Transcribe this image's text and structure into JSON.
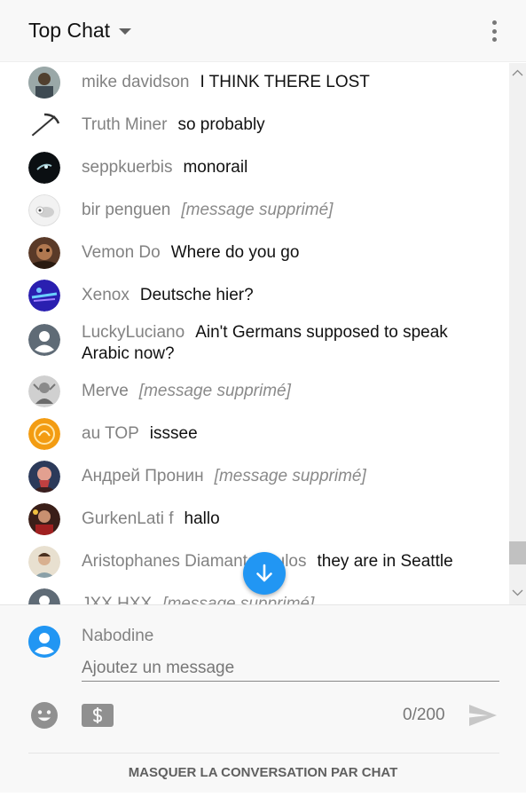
{
  "header": {
    "title": "Top Chat"
  },
  "messages": [
    {
      "author": "mike davidson",
      "text": "I THINK THERE LOST",
      "deleted": false,
      "avatar_color": "#6a7a80"
    },
    {
      "author": "Truth Miner",
      "text": "so probably",
      "deleted": false,
      "avatar_color": "#ffffff"
    },
    {
      "author": "seppkuerbis",
      "text": "monorail",
      "deleted": false,
      "avatar_color": "#0b0f12"
    },
    {
      "author": "bir penguen",
      "text": "[message supprimé]",
      "deleted": true,
      "avatar_color": "#e6e6e6"
    },
    {
      "author": "Vemon Do",
      "text": "Where do you go",
      "deleted": false,
      "avatar_color": "#5a3a28"
    },
    {
      "author": "Xenox",
      "text": "Deutsche hier?",
      "deleted": false,
      "avatar_color": "#2a1fb0"
    },
    {
      "author": "LuckyLuciano",
      "text": "Ain't Germans supposed to speak Arabic now?",
      "deleted": false,
      "avatar_color": "#5f6b76"
    },
    {
      "author": "Merve",
      "text": "[message supprimé]",
      "deleted": true,
      "avatar_color": "#b5b5b5"
    },
    {
      "author": "au TOP",
      "text": "isssee",
      "deleted": false,
      "avatar_color": "#f39c12"
    },
    {
      "author": "Андрей Пронин",
      "text": "[message supprimé]",
      "deleted": true,
      "avatar_color": "#8b3a3a"
    },
    {
      "author": "GurkenLati f",
      "text": "hallo",
      "deleted": false,
      "avatar_color": "#4a2a20"
    },
    {
      "author": "Aristophanes Diamantopoulos",
      "text": "they are in Seattle",
      "deleted": false,
      "avatar_color": "#c8b8a0"
    },
    {
      "author": "JXX HXX",
      "text": "[message supprimé]",
      "deleted": true,
      "avatar_color": "#5f6b76"
    }
  ],
  "composer": {
    "user_name": "Nabodine",
    "placeholder": "Ajoutez un message",
    "value": "",
    "counter": "0/200"
  },
  "footer": {
    "label": "MASQUER LA CONVERSATION PAR CHAT"
  },
  "icons": {
    "dropdown": "chevron-down-icon",
    "menu": "more-vertical-icon",
    "scroll_to_bottom": "arrow-down-icon",
    "emoji": "emoji-icon",
    "super_chat": "dollar-icon",
    "send": "send-icon"
  },
  "colors": {
    "accent": "#2196f3",
    "author_text": "#828282",
    "header_bg": "#f8f8f8"
  }
}
